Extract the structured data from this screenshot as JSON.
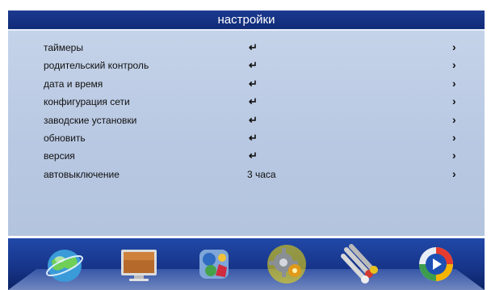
{
  "header": {
    "title": "настройки"
  },
  "menu": {
    "enter_glyph": "↵",
    "arrow_glyph": "›",
    "items": [
      {
        "label": "таймеры",
        "value": ""
      },
      {
        "label": "родительский контроль",
        "value": ""
      },
      {
        "label": "дата и время",
        "value": ""
      },
      {
        "label": "конфигурация сети",
        "value": ""
      },
      {
        "label": "заводские установки",
        "value": ""
      },
      {
        "label": "обновить",
        "value": ""
      },
      {
        "label": "версия",
        "value": ""
      },
      {
        "label": "автовыключение",
        "value": "3 часа"
      }
    ]
  },
  "dock": {
    "icons": [
      {
        "name": "globe-icon"
      },
      {
        "name": "tv-icon"
      },
      {
        "name": "puzzle-icon"
      },
      {
        "name": "settings-gear-icon",
        "selected": true
      },
      {
        "name": "av-cables-icon"
      },
      {
        "name": "media-play-icon"
      }
    ]
  },
  "colors": {
    "panel": "#bccbe4",
    "title_bar": "#17358a",
    "dock": "#1a3c93"
  }
}
